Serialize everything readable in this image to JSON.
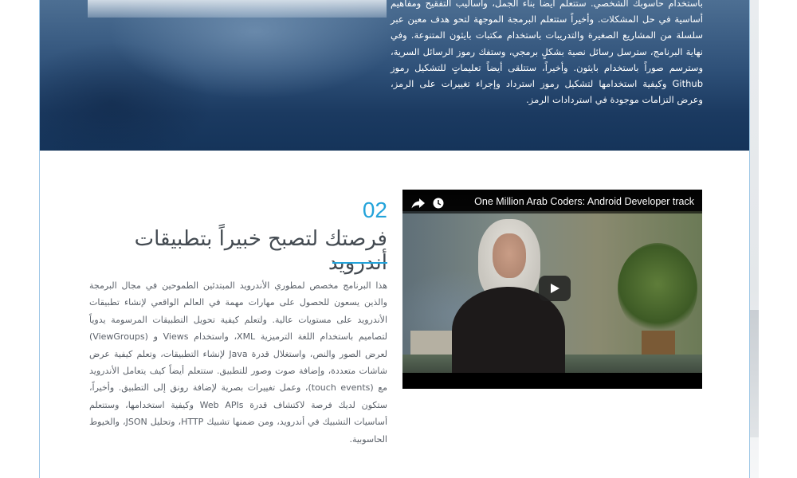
{
  "hero": {
    "paragraph": "باستخدام حاسوبك الشخصي. ستتعلم أيضاً بناء الجمل، وأساليب التفقيح ومفاهيم أساسية في حل المشكلات. وأخيراً ستتعلم البرمجة الموجهة لتحو هدف معين عبر سلسلة من المشاريع الصغيرة والتدريبات باستخدام مكتبات بايثون المتنوعة. وفي نهاية البرنامج، سترسل رسائل نصية بشكلٍ برمجي، وستفك رموز الرسائل السرية، وسترسم صوراً باستخدام بايثون. وأخيراً، ستتلقى أيضاً تعليماتٍ للتشكيل رموز Github وكيفية استخدامها لتشكيل رموز استرداد وإجراء تغييرات على الرمز، وعرض التزامات موجودة في استردادات الرمز."
  },
  "section": {
    "number": "02",
    "title": "فرصتك لتصبح خبيراً بتطبيقات أندرويد",
    "body": "هذا البرنامج مخصص لمطوري الأندرويد المبتدئين الطموحين في مجال البرمجة والذين يسعون للحصول على مهارات مهمة في العالم الواقعي لإنشاء تطبيقات الأندرويد على مستويات عالية. ولتعلم كيفية تحويل التطبيقات المرسومة يدوياً لتصاميم باستخدام اللغة الترميزية XML، واستخدام Views و (ViewGroups) لعرض الصور والنص، واستغلال قدرة Java لإنشاء التطبيقات، وتعلم كيفية عرض شاشات متعددة، وإضافة صوت وصور للتطبيق. ستتعلم أيضاً كيف يتعامل الأندرويد مع (touch events)، وعمل تغييرات بصرية لإضافة رونق إلى التطبيق. وأخيراً، ستكون لديك فرصة لاكتشاف قدرة Web APIs وكيفية استخدامها، وستتعلم أساسيات التشبيك في أندرويد، ومن ضمنها تشبيك HTTP، وتحليل JSON، والخيوط الحاسوبية."
  },
  "video": {
    "title": "One Million Arab Coders: Android Developer track",
    "icons": [
      "share-icon",
      "clock-icon",
      "play-icon"
    ]
  },
  "colors": {
    "accent": "#23a3da",
    "hero_dark": "#15345a",
    "title_text": "#444b52",
    "body_text": "#5b6169"
  }
}
